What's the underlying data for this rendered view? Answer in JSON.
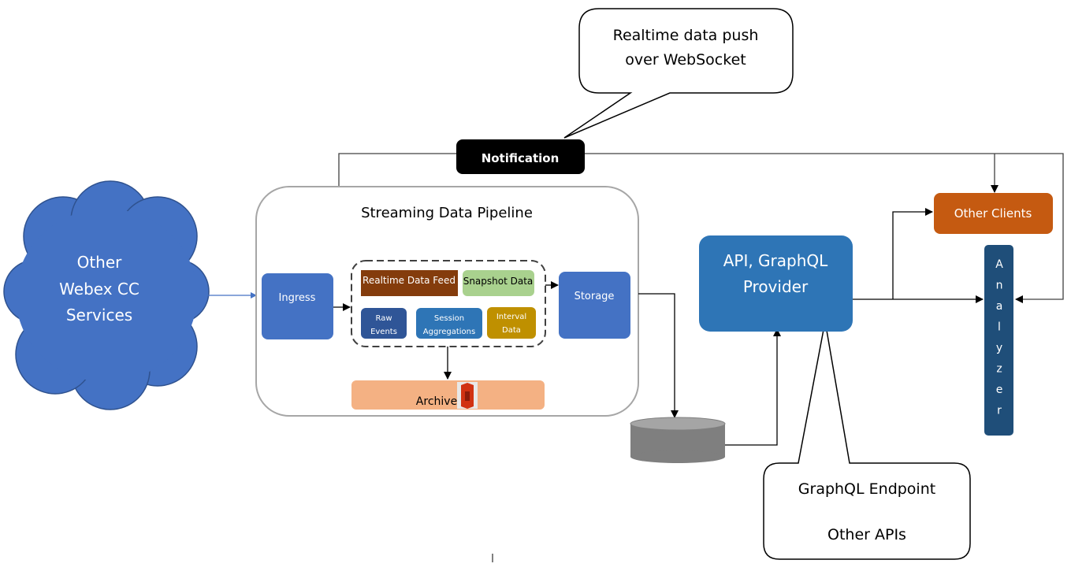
{
  "callout_top": {
    "line1": "Realtime data push",
    "line2": "over WebSocket"
  },
  "notification": {
    "label": "Notification"
  },
  "cloud": {
    "line1": "Other",
    "line2": "Webex CC",
    "line3": "Services"
  },
  "pipeline": {
    "title": "Streaming Data Pipeline",
    "ingress": "Ingress",
    "storage": "Storage",
    "realtime_feed": "Realtime Data Feed",
    "snapshot": "Snapshot  Data",
    "raw_events": {
      "line1": "Raw",
      "line2": "Events"
    },
    "session_aggregations": {
      "line1": "Session",
      "line2": "Aggregations"
    },
    "interval_data": {
      "line1": "Interval",
      "line2": "Data"
    },
    "archive": "Archive"
  },
  "api_provider": {
    "line1": "API, GraphQL",
    "line2": "Provider"
  },
  "callout_bottom": {
    "line1": "GraphQL Endpoint",
    "line2": "Other APIs"
  },
  "other_clients": "Other Clients",
  "analyzer": [
    "A",
    "n",
    "a",
    "l",
    "y",
    "z",
    "e",
    "r"
  ],
  "colors": {
    "cloud": "#4472c4",
    "ingress": "#4472c4",
    "realtime_feed": "#843c0c",
    "snapshot": "#a9d18e",
    "raw_events": "#2f5597",
    "session": "#2e75b6",
    "interval": "#bf9000",
    "archive": "#f4b183",
    "api": "#2e75b6",
    "other_clients": "#c55a11",
    "analyzer": "#1f4e79",
    "database": "#7f7f7f"
  }
}
